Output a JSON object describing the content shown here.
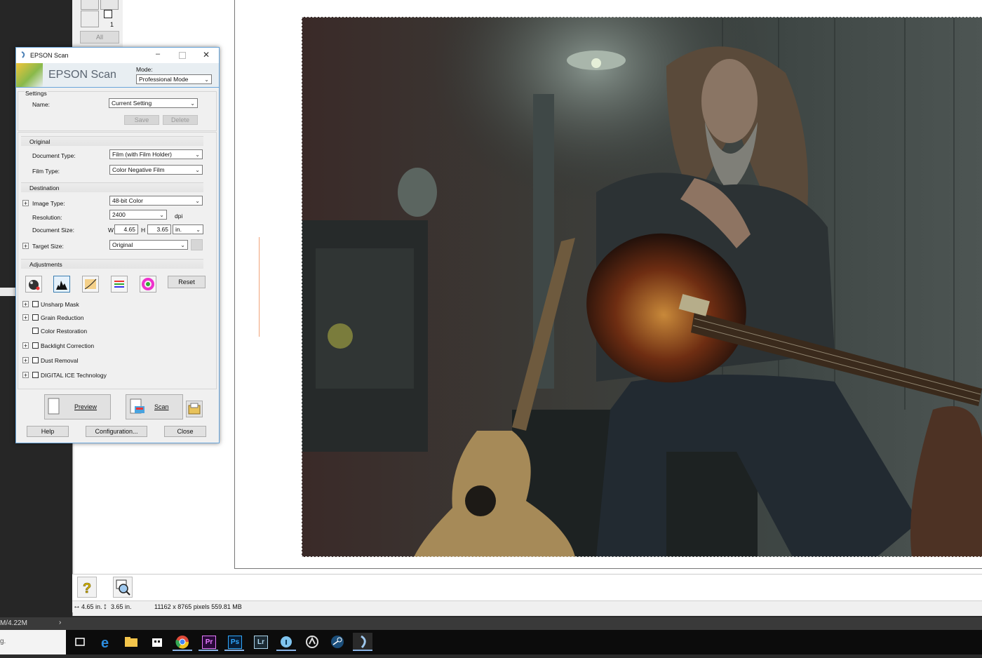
{
  "dialog": {
    "title": "EPSON Scan",
    "banner_title": "EPSON Scan",
    "mode_label": "Mode:",
    "mode_value": "Professional Mode",
    "settings": {
      "heading": "Settings",
      "name_label": "Name:",
      "name_value": "Current Setting",
      "save": "Save",
      "delete": "Delete"
    },
    "original": {
      "heading": "Original",
      "doc_type_label": "Document Type:",
      "doc_type_value": "Film (with Film Holder)",
      "film_type_label": "Film Type:",
      "film_type_value": "Color Negative Film"
    },
    "destination": {
      "heading": "Destination",
      "image_type_label": "Image Type:",
      "image_type_value": "48-bit Color",
      "resolution_label": "Resolution:",
      "resolution_value": "2400",
      "resolution_unit": "dpi",
      "doc_size_label": "Document Size:",
      "w_label": "W",
      "w_value": "4.65",
      "h_label": "H",
      "h_value": "3.65",
      "size_unit": "in.",
      "target_size_label": "Target Size:",
      "target_size_value": "Original"
    },
    "adjustments": {
      "heading": "Adjustments",
      "reset": "Reset",
      "options": [
        "Unsharp Mask",
        "Grain Reduction",
        "Color Restoration",
        "Backlight Correction",
        "Dust Removal",
        "DIGITAL ICE Technology"
      ]
    },
    "preview": "Preview",
    "scan": "Scan",
    "help": "Help",
    "configuration": "Configuration...",
    "close": "Close"
  },
  "preview_window": {
    "frame_number": "1",
    "all_button": "All",
    "status_width": "4.65 in.",
    "status_height": "3.65 in.",
    "status_pixels": "11162 x 8765 pixels 559.81 MB"
  },
  "background_app": {
    "memory": "M/4.22M",
    "chevron": "›",
    "left_stub": "g."
  },
  "taskbar": {
    "apps": [
      "Pr",
      "Ps",
      "Lr"
    ]
  },
  "colors": {
    "dialog_border": "#6aa6db",
    "taskbar": "#0c0c0c",
    "premiere": "#e77bff",
    "photoshop": "#31a8ff",
    "lightroom": "#add5ec"
  }
}
